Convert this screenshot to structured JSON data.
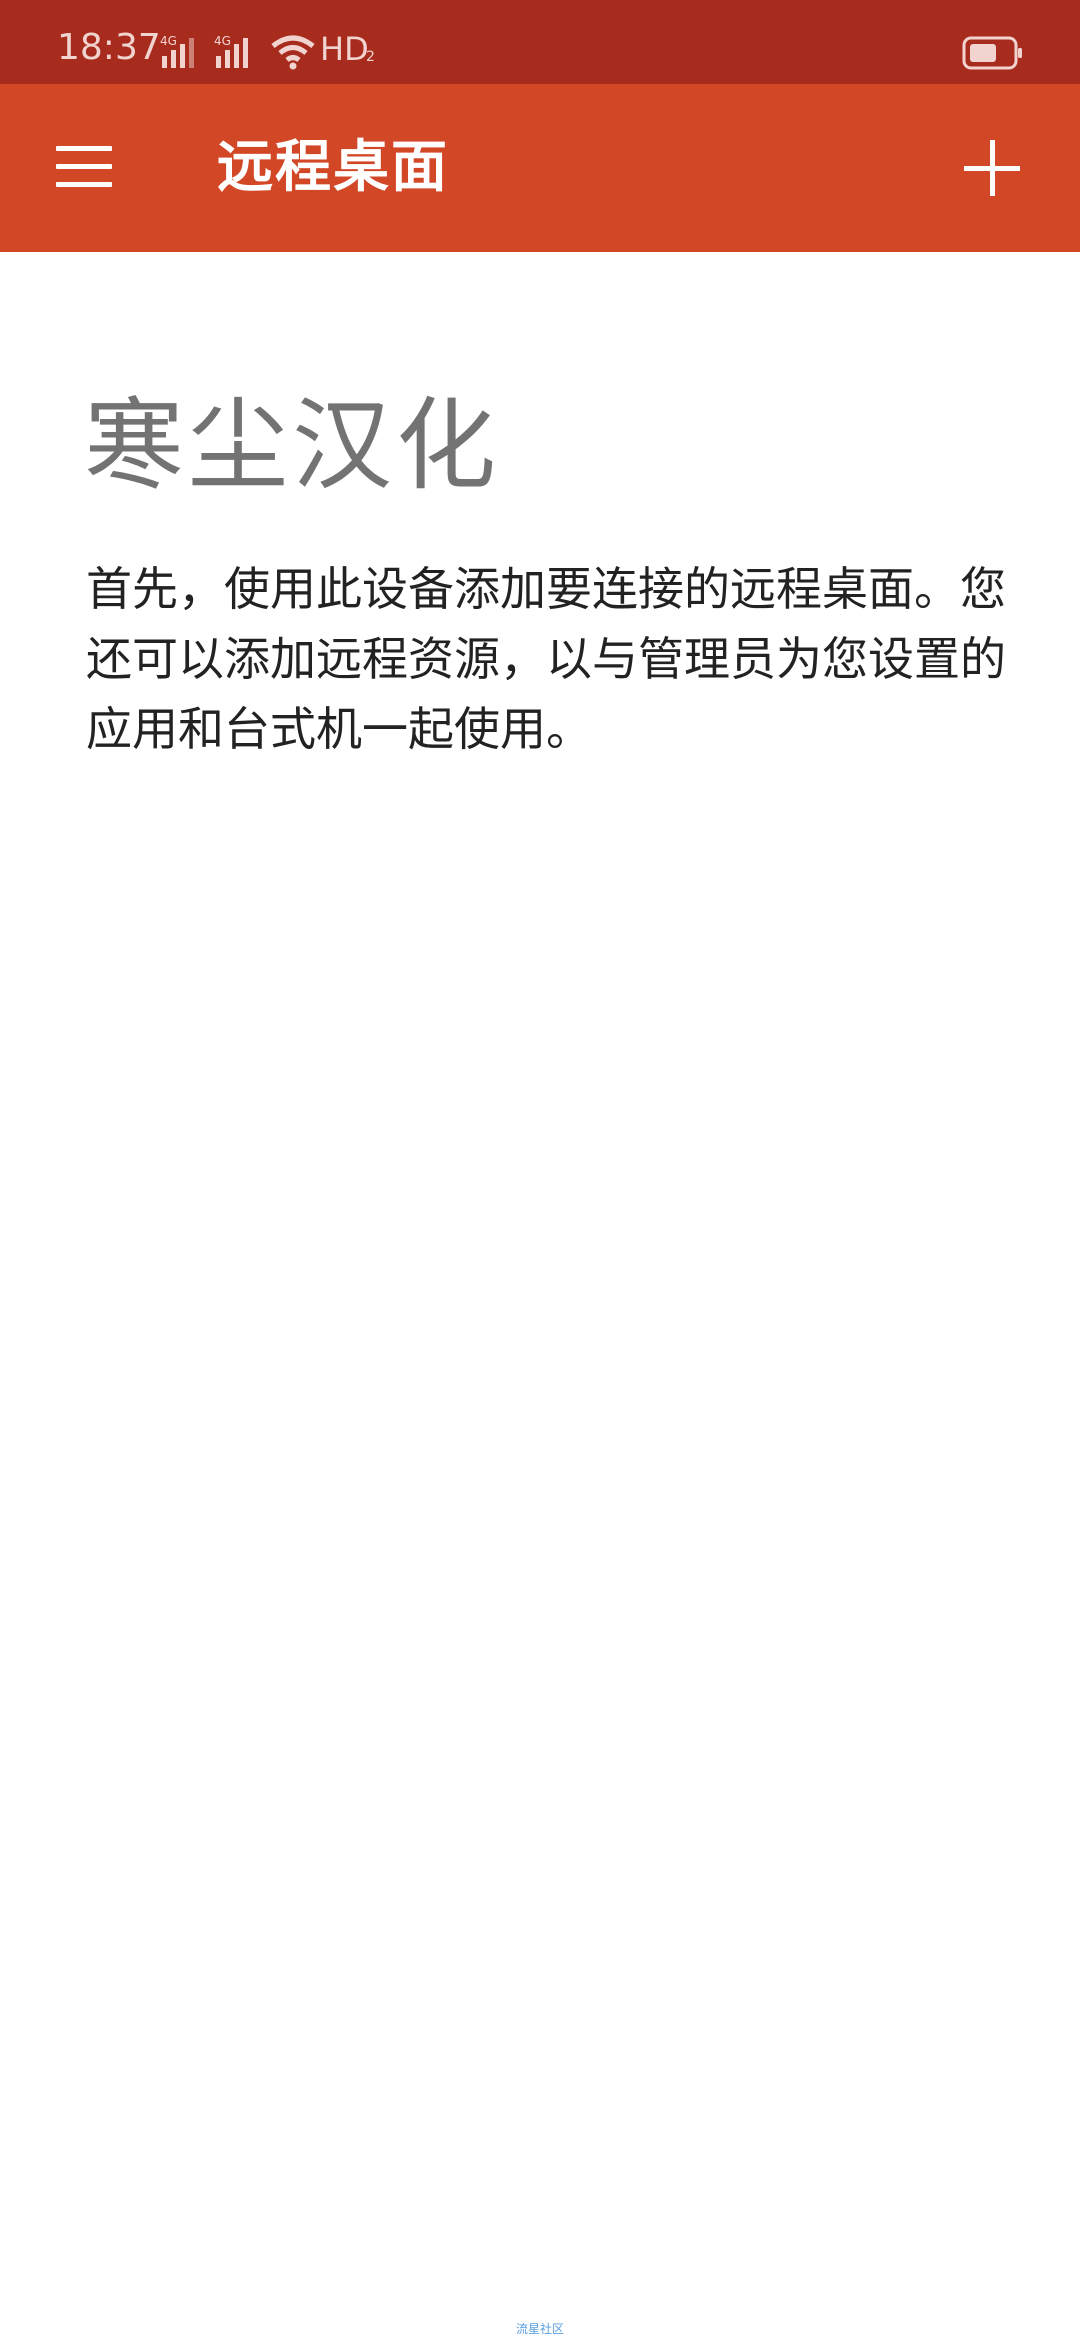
{
  "status_bar": {
    "time": "18:37",
    "network_1": "4G",
    "network_2": "4G",
    "hd_label": "HD",
    "hd_sub": "2",
    "icons": [
      "signal-icon",
      "signal-icon",
      "wifi-icon",
      "battery-icon"
    ]
  },
  "app_bar": {
    "title": "远程桌面",
    "menu_icon": "hamburger-menu-icon",
    "add_icon": "plus-icon"
  },
  "content": {
    "heading": "寒尘汉化",
    "intro": "首先，使用此设备添加要连接的远程桌面。您还可以添加远程资源，以与管理员为您设置的应用和台式机一起使用。"
  },
  "footer": {
    "watermark": "流星社区"
  },
  "colors": {
    "status_bar_bg": "#a82c1d",
    "app_bar_bg": "#d24726",
    "heading_text": "#737373",
    "body_text": "#222222"
  }
}
